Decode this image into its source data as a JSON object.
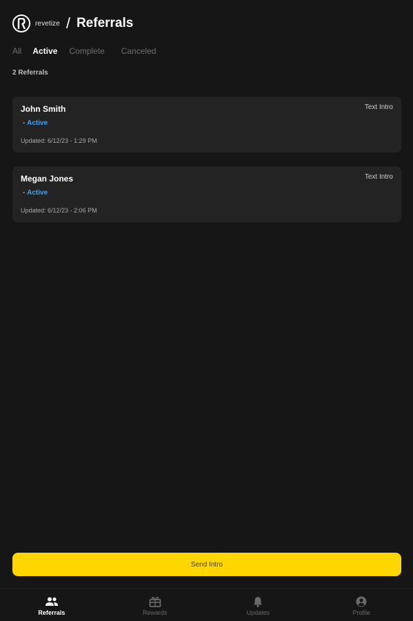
{
  "header": {
    "brand": "revetize",
    "separator": "/",
    "title": "Referrals"
  },
  "tabs": [
    {
      "label": "All",
      "active": false
    },
    {
      "label": "Active",
      "active": true
    },
    {
      "label": "Complete",
      "active": false
    },
    {
      "label": "Canceled",
      "active": false
    }
  ],
  "count_label": "2 Referrals",
  "referrals": [
    {
      "name": "John Smith",
      "type": "Text Intro",
      "status_prefix": "- ",
      "status": "Active",
      "updated": "Updated: 6/12/23 - 1:29 PM"
    },
    {
      "name": "Megan Jones",
      "type": "Text Intro",
      "status_prefix": "- ",
      "status": "Active",
      "updated": "Updated: 6/12/23 - 2:06 PM"
    }
  ],
  "send_button": "Send Intro",
  "nav": [
    {
      "label": "Referrals",
      "icon": "people-icon",
      "active": true
    },
    {
      "label": "Rewards",
      "icon": "gift-icon",
      "active": false
    },
    {
      "label": "Updates",
      "icon": "bell-icon",
      "active": false
    },
    {
      "label": "Profile",
      "icon": "account-circle-icon",
      "active": false
    }
  ],
  "colors": {
    "background": "#161616",
    "card": "#232323",
    "accent_yellow": "#ffd600",
    "status_blue": "#3ea5ff"
  }
}
